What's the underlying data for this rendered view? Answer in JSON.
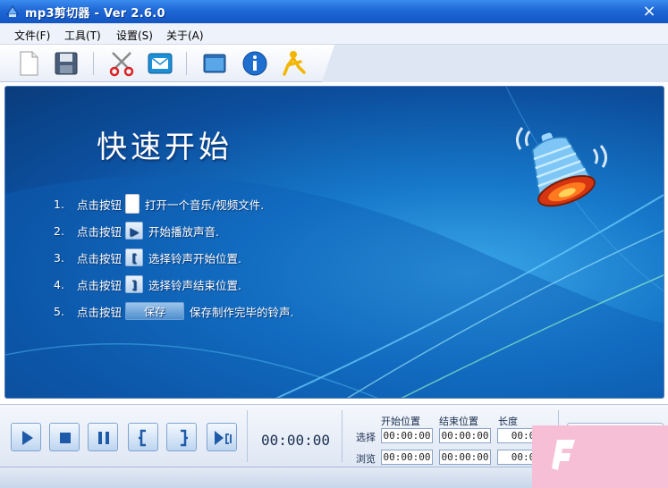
{
  "window": {
    "title": "mp3剪切器 - Ver 2.6.0",
    "close_glyph": "×"
  },
  "menu": [
    {
      "label": "文件(F)"
    },
    {
      "label": "工具(T)"
    },
    {
      "label": "设置(S)"
    },
    {
      "label": "关于(A)"
    }
  ],
  "toolbar": {
    "icons": [
      "new-file-icon",
      "save-icon",
      "scissors-icon",
      "email-icon",
      "window-icon",
      "info-icon",
      "aim-person-icon"
    ]
  },
  "quick_start": {
    "title": "快速开始",
    "steps": [
      {
        "num": "1.",
        "press": "点击按钮",
        "button_icon": "document-icon",
        "desc": "打开一个音乐/视频文件."
      },
      {
        "num": "2.",
        "press": "点击按钮",
        "button_icon": "play-icon",
        "button_glyph": "▶",
        "desc": "开始播放声音."
      },
      {
        "num": "3.",
        "press": "点击按钮",
        "button_icon": "start-bracket-icon",
        "button_glyph": "[",
        "desc": "选择铃声开始位置."
      },
      {
        "num": "4.",
        "press": "点击按钮",
        "button_icon": "end-bracket-icon",
        "button_glyph": "]",
        "desc": "选择铃声结束位置."
      },
      {
        "num": "5.",
        "press": "点击按钮",
        "button_label": "保存",
        "desc": "保存制作完毕的铃声."
      }
    ]
  },
  "controls": {
    "buttons": [
      "play-icon",
      "stop-icon",
      "pause-icon",
      "start-bracket-icon",
      "end-bracket-icon",
      "play-selection-icon"
    ],
    "time": "00:00:00",
    "columns": [
      "开始位置",
      "结束位置",
      "长度"
    ],
    "rows": [
      {
        "label": "选择",
        "start": "00:00:00",
        "end": "00:00:00",
        "length": "00:0"
      },
      {
        "label": "浏览",
        "start": "00:00:00",
        "end": "00:00:00",
        "length": "00:0"
      }
    ]
  },
  "colors": {
    "titlebar": "#1e67d6",
    "panel": "#1677c9",
    "watermark": "#f7bfd6"
  }
}
